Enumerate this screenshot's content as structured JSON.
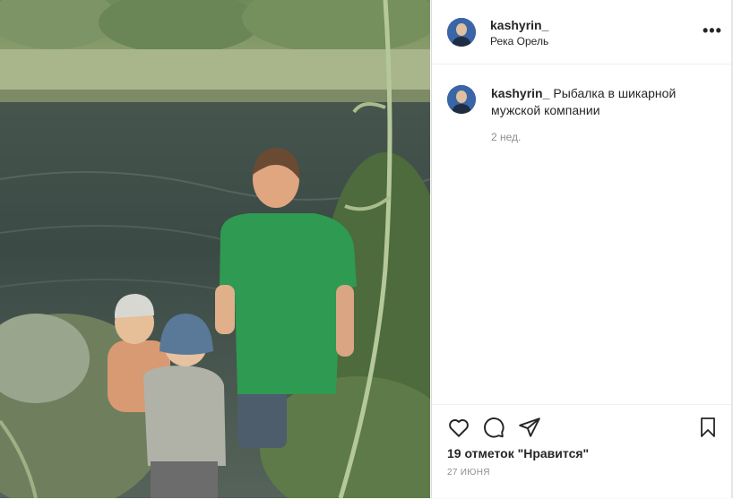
{
  "post": {
    "username": "kashyrin_",
    "location": "Река Орель",
    "caption": "Рыбалка в шикарной мужской компании",
    "caption_time": "2 нед.",
    "likes": "19 отметок \"Нравится\"",
    "date": "27 июня"
  },
  "icons": {
    "more": "more-options-icon",
    "like": "heart-icon",
    "comment": "comment-bubble-icon",
    "share": "paper-plane-icon",
    "save": "bookmark-icon"
  },
  "colors": {
    "text": "#262626",
    "secondary": "#8e8e8e",
    "border": "#dbdbdb"
  }
}
